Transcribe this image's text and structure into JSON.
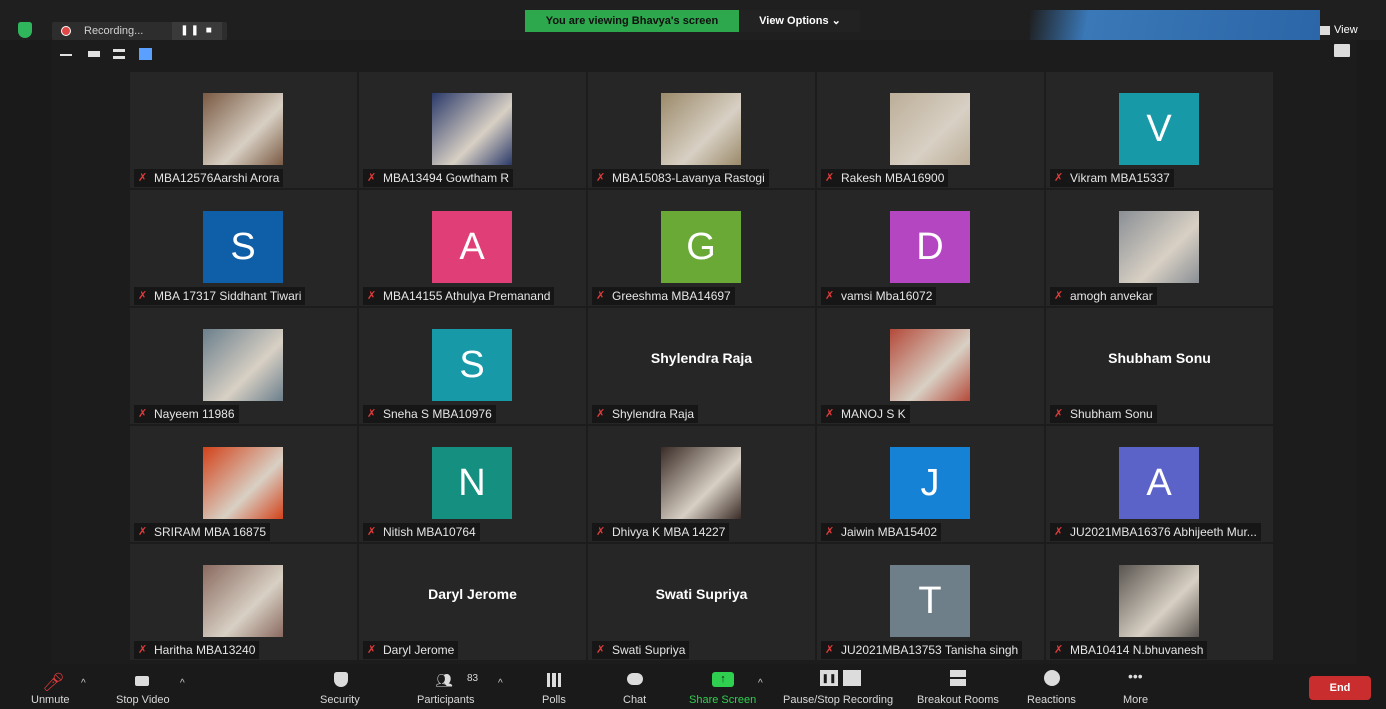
{
  "top": {
    "recording_label": "Recording...",
    "viewing_banner": "You are viewing Bhavya's screen",
    "view_options": "View Options ⌄",
    "view_label": "View"
  },
  "participants": [
    {
      "name": "MBA12576Aarshi Arora",
      "type": "photo",
      "color": "#7a5a43"
    },
    {
      "name": "MBA13494 Gowtham R",
      "type": "photo",
      "color": "#2b3a6a"
    },
    {
      "name": "MBA15083-Lavanya Rastogi",
      "type": "photo",
      "color": "#9b8a6a"
    },
    {
      "name": "Rakesh MBA16900",
      "type": "photo",
      "color": "#bcae98"
    },
    {
      "name": "Vikram MBA15337",
      "type": "avatar",
      "letter": "V",
      "color": "#1899a8"
    },
    {
      "name": "MBA 17317 Siddhant Tiwari",
      "type": "avatar",
      "letter": "S",
      "color": "#0e5ea8"
    },
    {
      "name": "MBA14155 Athulya Premanand",
      "type": "avatar",
      "letter": "A",
      "color": "#e03e77"
    },
    {
      "name": "Greeshma MBA14697",
      "type": "avatar",
      "letter": "G",
      "color": "#6aa935"
    },
    {
      "name": "vamsi Mba16072",
      "type": "avatar",
      "letter": "D",
      "color": "#b446c2"
    },
    {
      "name": "amogh anvekar",
      "type": "photo",
      "color": "#8a8f95"
    },
    {
      "name": "Nayeem 11986",
      "type": "photo",
      "color": "#6b7f8c"
    },
    {
      "name": "Sneha S MBA10976",
      "type": "avatar",
      "letter": "S",
      "color": "#1899a8"
    },
    {
      "name": "Shylendra Raja",
      "type": "text",
      "big": "Shylendra Raja"
    },
    {
      "name": "MANOJ S K",
      "type": "photo",
      "color": "#b44a3a"
    },
    {
      "name": "Shubham Sonu",
      "type": "text",
      "big": "Shubham Sonu"
    },
    {
      "name": "SRIRAM MBA 16875",
      "type": "photo",
      "color": "#d2421a"
    },
    {
      "name": "Nitish MBA10764",
      "type": "avatar",
      "letter": "N",
      "color": "#159080"
    },
    {
      "name": "Dhivya K MBA 14227",
      "type": "photo",
      "color": "#3a2b26"
    },
    {
      "name": "Jaiwin MBA15402",
      "type": "avatar",
      "letter": "J",
      "color": "#1582d6"
    },
    {
      "name": "JU2021MBA16376 Abhijeeth Mur...",
      "type": "avatar",
      "letter": "A",
      "color": "#5b63c8"
    },
    {
      "name": "Haritha MBA13240",
      "type": "photo",
      "color": "#8a6a60"
    },
    {
      "name": "Daryl Jerome",
      "type": "text",
      "big": "Daryl Jerome"
    },
    {
      "name": "Swati Supriya",
      "type": "text",
      "big": "Swati Supriya"
    },
    {
      "name": "JU2021MBA13753 Tanisha singh",
      "type": "avatar",
      "letter": "T",
      "color": "#6e7f8a"
    },
    {
      "name": "MBA10414 N.bhuvanesh",
      "type": "photo",
      "color": "#5a5550"
    }
  ],
  "toolbar": {
    "unmute": "Unmute",
    "stop_video": "Stop Video",
    "security": "Security",
    "participants": "Participants",
    "participants_count": "83",
    "polls": "Polls",
    "chat": "Chat",
    "share_screen": "Share Screen",
    "pause_recording": "Pause/Stop Recording",
    "breakout": "Breakout Rooms",
    "reactions": "Reactions",
    "more": "More",
    "end": "End"
  },
  "colors": {
    "share_green": "#2fd04f",
    "end_red": "#c92d2d",
    "mic_off": "#e23b3b"
  }
}
